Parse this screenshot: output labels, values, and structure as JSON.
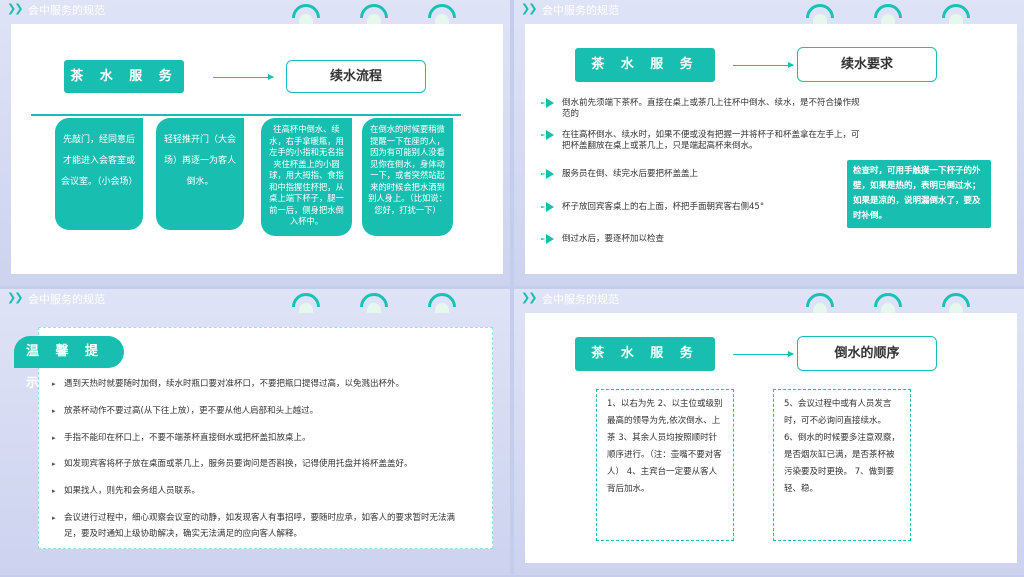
{
  "header": {
    "title": "会中服务的规范",
    "chevron": "❯❯"
  },
  "slide1": {
    "pill": "茶 水 服 务",
    "box": "续水流程",
    "cards": [
      "先敲门，经同意后才能进入会客室或会议室。（小会场）",
      "轻轻推开门（大会场）再逐一为客人倒水。",
      "往高杯中倒水、续水，右手拿暖瓶，用左手的小指和无名指夹住杯盖上的小圆球，用大拇指、食指和中指握住杯把，从桌上端下杯子，腿一前一后，侧身把水倒入杯中。",
      "在倒水的时候要稍微提醒一下在座的人，因为有可能别人没看见你在倒水，身体动一下，或者突然站起来的时候会把水洒到别人身上。（比如说：您好，打扰一下）"
    ]
  },
  "slide2": {
    "pill": "茶 水 服 务",
    "box": "续水要求",
    "bullets": [
      "倒水前先须端下茶杯。直接在桌上或茶几上往杯中倒水、续水，是不符合操作规范的",
      "在往高杯倒水、续水时，如果不便或没有把握一并将杯子和杯盖拿在左手上，可把杯盖翻放在桌上或茶几上，只是端起高杯来倒水。",
      "服务员在倒、续完水后要把杯盖盖上",
      "杯子放回宾客桌上的右上面，杯把手面朝宾客右侧45°",
      "倒过水后，要逐杯加以检查"
    ],
    "note": "检查时，可用手触摸一下杯子的外壁，如果是热的，表明已倒过水；如果是凉的，说明漏倒水了，要及时补倒。"
  },
  "slide3": {
    "tag": "温 馨 提 示",
    "items": [
      "遇到天热时就要随时加倒，续水时瓶口要对准杯口，不要把瓶口提得过高，以免溅出杯外。",
      "放茶杯动作不要过高(从下往上放），更不要从他人肩部和头上越过。",
      "手指不能印在杯口上，不要不端茶杯直接倒水或把杯盖扣放桌上。",
      "如发现宾客将杯子放在桌面或茶几上，服务员要询问是否斟换，记得使用托盘并将杯盖盖好。",
      "如果找人，则先和会务组人员联系。",
      "会议进行过程中，细心观察会议室的动静，如发现客人有事招呼，要随时应承，如客人的要求暂时无法满足，要及时通知上级协助解决，确实无法满足的应向客人解释。"
    ]
  },
  "slide4": {
    "pill": "茶 水 服 务",
    "box": "倒水的顺序",
    "left": "1、以右为先 2、以主位或级别最高的领导为先,依次倒水、上茶 3、其余人员均按照顺时针顺序进行。（注：壶嘴不要对客人） 4、主宾台一定要从客人背后加水。",
    "right": "5、会议过程中或有人员发言时，可不必询问直接续水。 6、倒水的时候要多注意观察，是否烟灰缸已满，是否茶杯被　污染要及时更换。 7、做到要轻、稳。"
  }
}
